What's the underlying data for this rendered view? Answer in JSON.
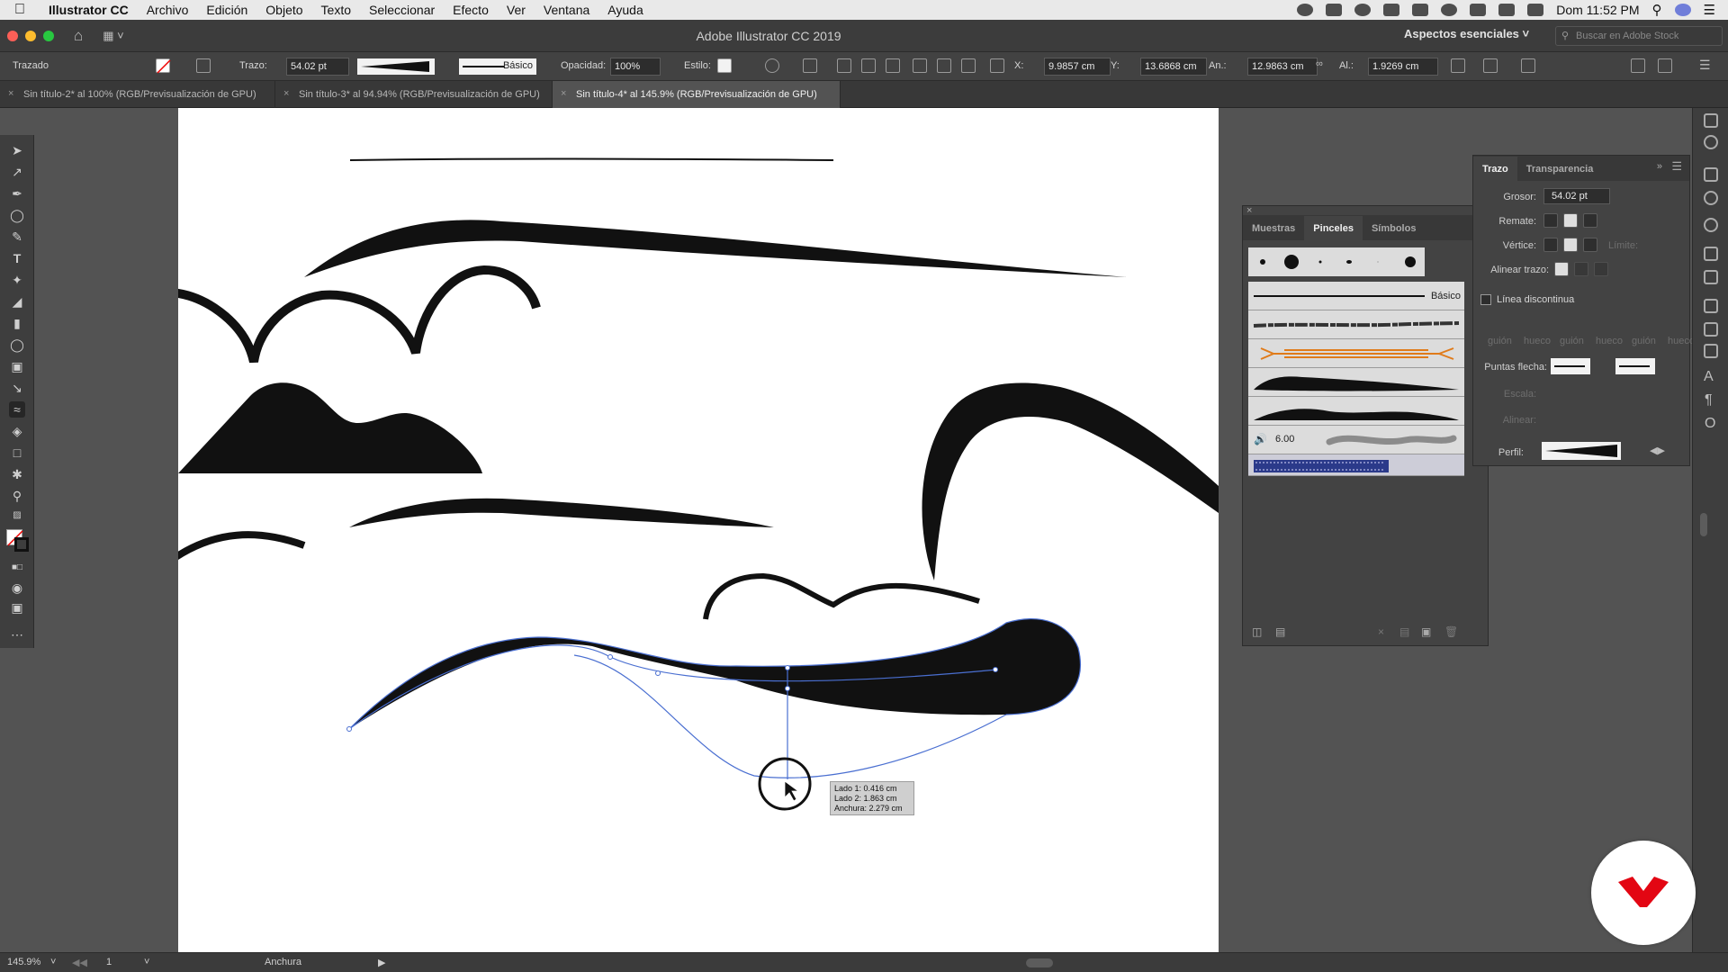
{
  "menubar": {
    "app_name": "Illustrator CC",
    "items": [
      "Archivo",
      "Edición",
      "Objeto",
      "Texto",
      "Seleccionar",
      "Efecto",
      "Ver",
      "Ventana",
      "Ayuda"
    ],
    "clock": "Dom 11:52 PM"
  },
  "window": {
    "title": "Adobe Illustrator CC 2019",
    "workspace": "Aspectos esenciales",
    "search_placeholder": "Buscar en Adobe Stock"
  },
  "controlbar": {
    "selection_type": "Trazado",
    "stroke_label": "Trazo:",
    "stroke_value": "54.02 pt",
    "brush_name": "Básico",
    "opacity_label": "Opacidad:",
    "opacity_value": "100%",
    "style_label": "Estilo:",
    "x_label": "X:",
    "x_value": "9.9857 cm",
    "y_label": "Y:",
    "y_value": "13.6868 cm",
    "w_label": "An.:",
    "w_value": "12.9863 cm",
    "h_label": "Al.:",
    "h_value": "1.9269 cm"
  },
  "doc_tabs": [
    {
      "label": "Sin título-2* al 100% (RGB/Previsualización de GPU)",
      "active": false
    },
    {
      "label": "Sin título-3* al 94.94% (RGB/Previsualización de GPU)",
      "active": false
    },
    {
      "label": "Sin título-4* al 145.9% (RGB/Previsualización de GPU)",
      "active": true
    }
  ],
  "brush_panel": {
    "tabs": [
      "Muestras",
      "Pinceles",
      "Símbolos"
    ],
    "active_tab": "Pinceles",
    "basic_label": "Básico",
    "bristle_size": "6.00"
  },
  "stroke_panel": {
    "tabs": [
      "Trazo",
      "Transparencia"
    ],
    "active_tab": "Trazo",
    "weight_label": "Grosor:",
    "weight_value": "54.02 pt",
    "cap_label": "Remate:",
    "corner_label": "Vértice:",
    "limit_label": "Límite:",
    "align_label": "Alinear trazo:",
    "dashed_label": "Línea discontinua",
    "dash_labels": [
      "guión",
      "hueco",
      "guión",
      "hueco",
      "guión",
      "hueco"
    ],
    "arrowheads_label": "Puntas flecha:",
    "scale_label": "Escala:",
    "align_arrows_label": "Alinear:",
    "profile_label": "Perfil:"
  },
  "tooltip": {
    "line1": "Lado 1: 0.416 cm",
    "line2": "Lado 2: 1.863 cm",
    "line3": "Anchura:  2.279 cm"
  },
  "statusbar": {
    "zoom": "145.9%",
    "artboard_number": "1",
    "current_tool": "Anchura"
  },
  "colors": {
    "accent_path": "#4a6fd1",
    "ui_dark": "#535353",
    "watermark_red": "#e30613"
  }
}
